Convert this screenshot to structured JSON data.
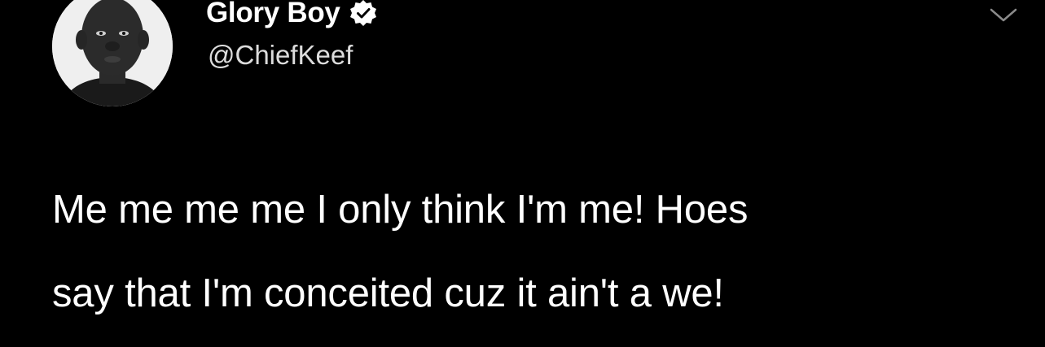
{
  "tweet": {
    "author": {
      "display_name": "Glory Boy",
      "handle": "@ChiefKeef",
      "verified": true,
      "avatar_icon": "profile-photo"
    },
    "menu_icon": "chevron-down-icon",
    "text": "Me me me me I only think I'm me! Hoes\nsay that I'm conceited cuz it ain't a we!"
  },
  "colors": {
    "background": "#000000",
    "text": "#ffffff",
    "handle": "#dcdcdc",
    "verified_badge": "#ffffff",
    "chevron": "#8a8a8a"
  }
}
